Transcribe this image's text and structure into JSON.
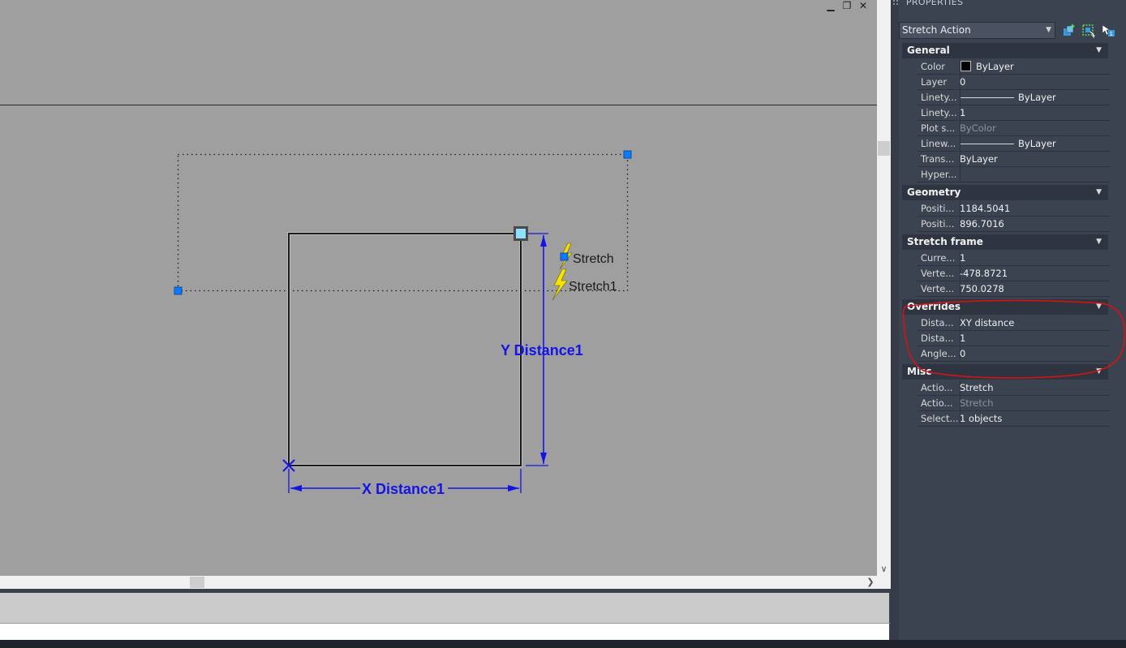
{
  "window_controls": {
    "minimize": "▁",
    "restore": "❐",
    "close": "✕"
  },
  "drawing": {
    "stretch_label_1": "Stretch",
    "stretch_label_2": "Stretch1",
    "y_param": "Y  Distance1",
    "x_param": "X  Distance1"
  },
  "colors": {
    "drawing_bg": "#9f9f9f",
    "param_blue": "#1414e6",
    "grip_blue": "#0a7cff",
    "bolt_yellow": "#f5e400",
    "panel_bg": "#3b4350",
    "annotation_red": "#e01010"
  },
  "properties": {
    "title": "PROPERTIES",
    "selector_value": "Stretch Action",
    "tool_icons": [
      "quick-select-icon",
      "select-objects-icon",
      "toggle-pickadd-icon"
    ],
    "sections": [
      {
        "title": "General",
        "rows": [
          {
            "name": "Color",
            "value": "ByLayer"
          },
          {
            "name": "Layer",
            "value": "0"
          },
          {
            "name": "Linety...",
            "value": "ByLayer"
          },
          {
            "name": "Linety...",
            "value": "1"
          },
          {
            "name": "Plot s...",
            "value": "ByColor"
          },
          {
            "name": "Linew...",
            "value": "ByLayer"
          },
          {
            "name": "Trans...",
            "value": "ByLayer"
          },
          {
            "name": "Hyper...",
            "value": ""
          }
        ]
      },
      {
        "title": "Geometry",
        "rows": [
          {
            "name": "Positi...",
            "value": "1184.5041"
          },
          {
            "name": "Positi...",
            "value": "896.7016"
          }
        ]
      },
      {
        "title": "Stretch frame",
        "rows": [
          {
            "name": "Curre...",
            "value": "1"
          },
          {
            "name": "Verte...",
            "value": "-478.8721"
          },
          {
            "name": "Verte...",
            "value": "750.0278"
          }
        ]
      },
      {
        "title": "Overrides",
        "rows": [
          {
            "name": "Dista...",
            "value": "XY distance"
          },
          {
            "name": "Dista...",
            "value": "1"
          },
          {
            "name": "Angle...",
            "value": "0"
          }
        ]
      },
      {
        "title": "Misc",
        "rows": [
          {
            "name": "Actio...",
            "value": "Stretch"
          },
          {
            "name": "Actio...",
            "value": "Stretch"
          },
          {
            "name": "Select...",
            "value": "1 objects"
          }
        ]
      }
    ]
  }
}
